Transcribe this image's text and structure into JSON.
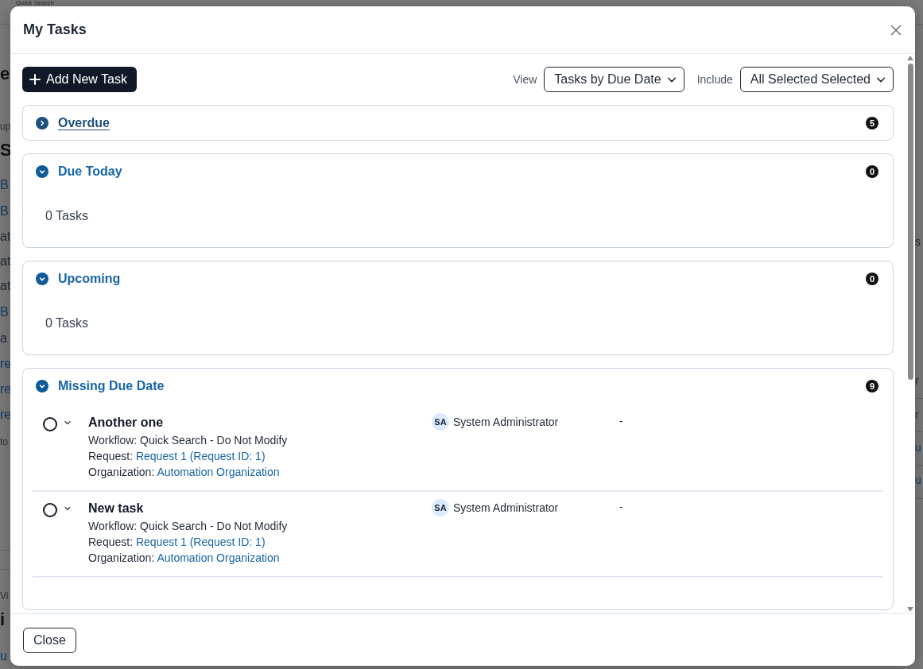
{
  "backdrop": {
    "title": "Quick Search",
    "left_fragments": [
      {
        "text": "e",
        "kind": "heading"
      },
      {
        "text": "up",
        "kind": "small"
      },
      {
        "text": "S",
        "kind": "heading"
      },
      {
        "text": "B",
        "kind": "link"
      },
      {
        "text": "B",
        "kind": "link"
      },
      {
        "text": "at",
        "kind": "text"
      },
      {
        "text": "at",
        "kind": "text"
      },
      {
        "text": "at",
        "kind": "text"
      },
      {
        "text": "B",
        "kind": "link"
      },
      {
        "text": "a",
        "kind": "text"
      },
      {
        "text": "re",
        "kind": "link"
      },
      {
        "text": "re",
        "kind": "link"
      },
      {
        "text": "re",
        "kind": "link"
      },
      {
        "text": "to",
        "kind": "small"
      },
      {
        "text": "Vi",
        "kind": "small"
      },
      {
        "text": "i",
        "kind": "heading"
      },
      {
        "text": "u",
        "kind": "link"
      }
    ],
    "right_fragments": [
      {
        "text": "s",
        "kind": "text"
      },
      {
        "text": "r",
        "kind": "text"
      },
      {
        "text": "r",
        "kind": "link"
      },
      {
        "text": "u",
        "kind": "link"
      },
      {
        "text": "u",
        "kind": "link"
      }
    ]
  },
  "dialog": {
    "title": "My Tasks"
  },
  "toolbar": {
    "add_button": "Add New Task",
    "view_label": "View",
    "view_value": "Tasks by Due Date",
    "include_label": "Include",
    "include_value": "All Selected Selected"
  },
  "groups": [
    {
      "title": "Overdue",
      "count": "5",
      "expanded": false
    },
    {
      "title": "Due Today",
      "count": "0",
      "expanded": true,
      "empty_text": "0 Tasks"
    },
    {
      "title": "Upcoming",
      "count": "0",
      "expanded": true,
      "empty_text": "0 Tasks"
    },
    {
      "title": "Missing Due Date",
      "count": "9",
      "expanded": true,
      "tasks": [
        {
          "title": "Another one",
          "completed": false,
          "workflow_label": "Workflow:",
          "workflow": "Quick Search - Do Not Modify",
          "request_label": "Request:",
          "request": "Request 1 (Request ID: 1)",
          "organization_label": "Organization:",
          "organization": "Automation Organization",
          "assignee_initials": "SA",
          "assignee": "System Administrator",
          "due": "-"
        },
        {
          "title": "New task",
          "completed": false,
          "workflow_label": "Workflow:",
          "workflow": "Quick Search - Do Not Modify",
          "request_label": "Request:",
          "request": "Request 1 (Request ID: 1)",
          "organization_label": "Organization:",
          "organization": "Automation Organization",
          "assignee_initials": "SA",
          "assignee": "System Administrator",
          "due": "-"
        }
      ]
    }
  ],
  "footer": {
    "close_button": "Close"
  }
}
